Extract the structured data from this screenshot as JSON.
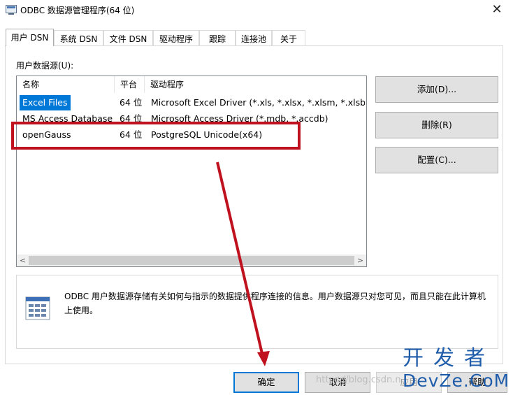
{
  "window": {
    "title": "ODBC 数据源管理程序(64 位)",
    "close_glyph": "✕"
  },
  "tabs": [
    {
      "label": "用户 DSN",
      "active": true
    },
    {
      "label": "系统 DSN",
      "active": false
    },
    {
      "label": "文件 DSN",
      "active": false
    },
    {
      "label": "驱动程序",
      "active": false
    },
    {
      "label": "跟踪",
      "active": false
    },
    {
      "label": "连接池",
      "active": false
    },
    {
      "label": "关于",
      "active": false
    }
  ],
  "list": {
    "label": "用户数据源(U):",
    "columns": [
      "名称",
      "平台",
      "驱动程序"
    ],
    "rows": [
      {
        "name": "Excel Files",
        "platform": "64 位",
        "driver": "Microsoft Excel Driver (*.xls, *.xlsx, *.xlsm, *.xlsb)",
        "selected": true
      },
      {
        "name": "MS Access Database",
        "platform": "64 位",
        "driver": "Microsoft Access Driver (*.mdb, *.accdb)",
        "selected": false
      },
      {
        "name": "openGauss",
        "platform": "64 位",
        "driver": "PostgreSQL Unicode(x64)",
        "selected": false
      }
    ],
    "scroll_left_glyph": "<",
    "scroll_right_glyph": ">"
  },
  "buttons": {
    "add": "添加(D)...",
    "remove": "删除(R)",
    "configure": "配置(C)..."
  },
  "info": {
    "icon": "datasource-icon",
    "text": "ODBC 用户数据源存储有关如何与指示的数据提供程序连接的信息。用户数据源只对您可见，而且只能在此计算机上使用。"
  },
  "footer": {
    "ok": "确定",
    "cancel": "取消",
    "apply": "应用",
    "help": "帮助"
  },
  "annotation": {
    "color": "#c0111f",
    "icon": "arrow-icon"
  },
  "watermark": {
    "url": "https://blog.csdn.n",
    "brand_cn": "开发者",
    "brand_en": "DevZe.CoM"
  }
}
